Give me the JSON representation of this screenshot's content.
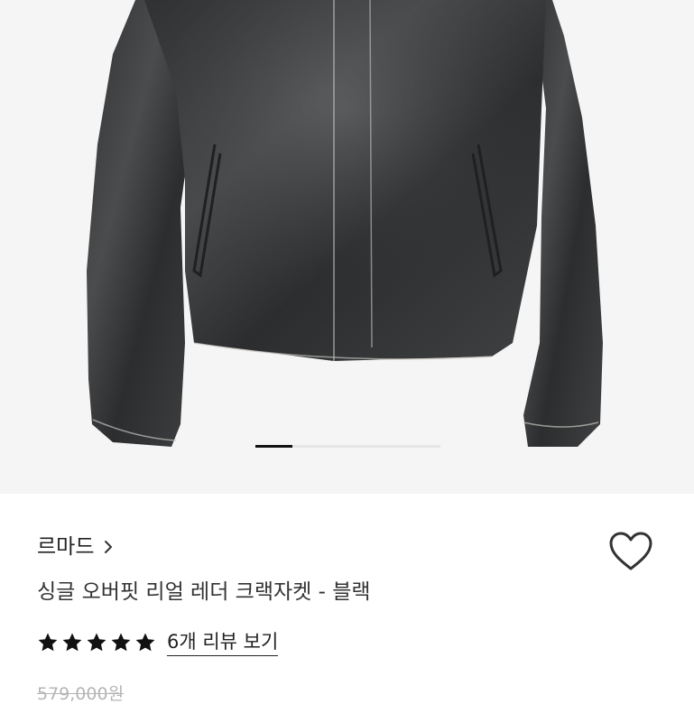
{
  "product": {
    "image_alt": "black leather jacket",
    "gallery_progress": 0.2,
    "brand": "르마드",
    "name": "싱글 오버핏 리얼 레더 크랙자켓 - 블랙",
    "rating": {
      "stars": 5,
      "max": 5,
      "review_link": "6개 리뷰 보기"
    },
    "original_price_partial": "579,000원"
  },
  "colors": {
    "hero_bg": "#f5f5f5",
    "leather": "#3a3c3e",
    "stitch": "#c9c5bd",
    "text": "#222222",
    "star": "#111111"
  },
  "icons": {
    "brand_chevron": "chevron-right-icon",
    "wishlist": "heart-outline-icon",
    "rating_star": "star-filled-icon"
  }
}
